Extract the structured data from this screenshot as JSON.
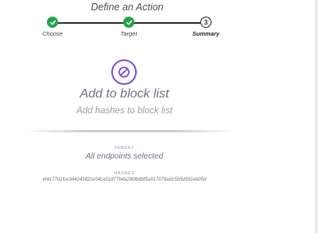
{
  "header": {
    "title": "Define an Action"
  },
  "stepper": {
    "steps": [
      {
        "label": "Choose",
        "state": "done"
      },
      {
        "label": "Target",
        "state": "done"
      },
      {
        "label": "Summary",
        "state": "current",
        "number": "3"
      }
    ]
  },
  "action": {
    "icon": "block-icon",
    "title": "Add to block list",
    "subtitle": "Add hashes to block list"
  },
  "summary": {
    "target_label": "TARGET",
    "target_value": "All endpoints selected",
    "hashes_label": "HASHES",
    "hashes_value": "ef4177d1fce34424582ce54ca51d77b4a290fb8bf5a917079a915b5d591eb05d"
  },
  "colors": {
    "step_done": "#21a447",
    "accent": "#7b4dd1",
    "line": "#2b2f36"
  }
}
